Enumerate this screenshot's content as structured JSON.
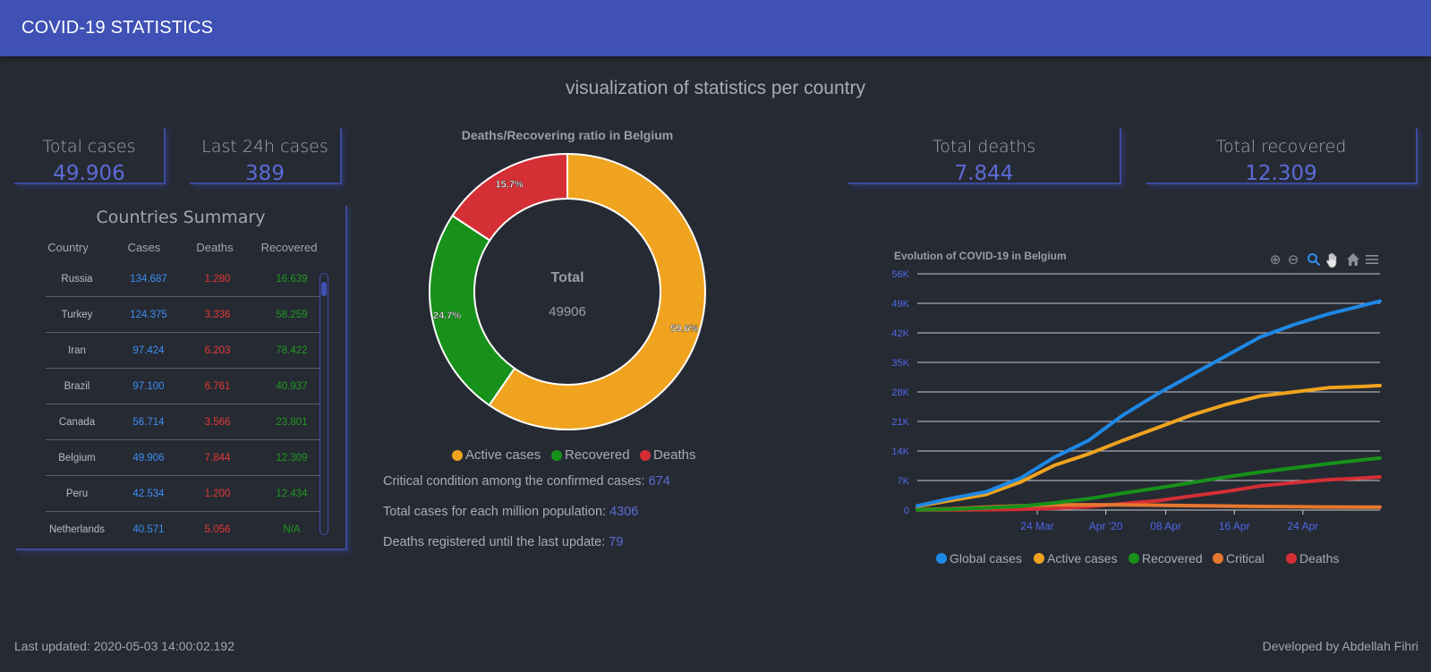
{
  "app": {
    "title": "COVID-19 STATISTICS"
  },
  "subtitle": "visualization of statistics per country",
  "cards": {
    "total_cases": {
      "label": "Total cases",
      "value": "49.906"
    },
    "last24h": {
      "label": "Last 24h cases",
      "value": "389"
    },
    "total_deaths": {
      "label": "Total deaths",
      "value": "7.844"
    },
    "total_recovered": {
      "label": "Total recovered",
      "value": "12.309"
    }
  },
  "summary": {
    "title": "Countries Summary",
    "headers": [
      "Country",
      "Cases",
      "Deaths",
      "Recovered"
    ],
    "rows": [
      [
        "Russia",
        "134.687",
        "1.280",
        "16.639"
      ],
      [
        "Turkey",
        "124.375",
        "3.336",
        "58.259"
      ],
      [
        "Iran",
        "97.424",
        "6.203",
        "78.422"
      ],
      [
        "Brazil",
        "97.100",
        "6.761",
        "40.937"
      ],
      [
        "Canada",
        "56.714",
        "3.566",
        "23.801"
      ],
      [
        "Belgium",
        "49.906",
        "7.844",
        "12.309"
      ],
      [
        "Peru",
        "42.534",
        "1.200",
        "12.434"
      ],
      [
        "Netherlands",
        "40.571",
        "5.056",
        "N/A"
      ]
    ]
  },
  "donut": {
    "title": "Deaths/Recovering ratio in Belgium",
    "center_label": "Total",
    "center_value": "49906",
    "legend": [
      "Active cases",
      "Recovered",
      "Deaths"
    ]
  },
  "stats": {
    "critical_label": "Critical condition among the confirmed cases: ",
    "critical_value": "674",
    "million_label": "Total cases for each million population: ",
    "million_value": "4306",
    "deaths_label": "Deaths registered until the last update: ",
    "deaths_value": "79"
  },
  "line_chart": {
    "title": "Evolution of COVID-19 in Belgium",
    "legend": [
      "Global cases",
      "Active cases",
      "Recovered",
      "Critical",
      "Deaths"
    ],
    "toolbar": [
      "zoom-in-icon",
      "zoom-out-icon",
      "zoom-select-icon",
      "pan-hand-icon",
      "home-icon",
      "menu-icon"
    ]
  },
  "chart_data": [
    {
      "type": "pie",
      "title": "Deaths/Recovering ratio in Belgium",
      "categories": [
        "Active cases",
        "Recovered",
        "Deaths"
      ],
      "values": [
        59.6,
        24.7,
        15.7
      ],
      "labels": [
        "59.6%",
        "24.7%",
        "15.7%"
      ],
      "colors": [
        "#f0a31e",
        "#17911a",
        "#d42f35"
      ]
    },
    {
      "type": "line",
      "title": "Evolution of COVID-19 in Belgium",
      "x_ticks": [
        "24 Mar",
        "Apr '20",
        "08 Apr",
        "16 Apr",
        "24 Apr"
      ],
      "y_ticks": [
        "0",
        "7K",
        "14K",
        "21K",
        "28K",
        "35K",
        "42K",
        "49K",
        "56K"
      ],
      "ylim": [
        0,
        56000
      ],
      "x": [
        "2020-03-10",
        "2020-03-14",
        "2020-03-18",
        "2020-03-22",
        "2020-03-26",
        "2020-03-30",
        "2020-04-03",
        "2020-04-07",
        "2020-04-11",
        "2020-04-15",
        "2020-04-19",
        "2020-04-23",
        "2020-04-27",
        "2020-05-01",
        "2020-05-03"
      ],
      "series": [
        {
          "name": "Global cases",
          "color": "#1e88e5",
          "values": [
            1000,
            2800,
            4300,
            7500,
            12500,
            16500,
            22500,
            27500,
            32000,
            36500,
            41000,
            44000,
            46500,
            48500,
            49500
          ]
        },
        {
          "name": "Active cases",
          "color": "#f0a31e",
          "values": [
            900,
            2300,
            3700,
            6600,
            10600,
            13300,
            16500,
            19500,
            22500,
            25000,
            27000,
            28000,
            29000,
            29300,
            29500
          ]
        },
        {
          "name": "Recovered",
          "color": "#17911a",
          "values": [
            50,
            200,
            500,
            900,
            1700,
            2700,
            4000,
            5200,
            6500,
            7800,
            9000,
            10000,
            11000,
            11900,
            12300
          ]
        },
        {
          "name": "Critical",
          "color": "#e8772e",
          "values": [
            100,
            300,
            700,
            1000,
            1200,
            1250,
            1200,
            1150,
            1050,
            950,
            850,
            780,
            720,
            690,
            674
          ]
        },
        {
          "name": "Deaths",
          "color": "#d42f35",
          "values": [
            10,
            30,
            80,
            180,
            400,
            800,
            1500,
            2200,
            3300,
            4400,
            5700,
            6500,
            7200,
            7600,
            7844
          ]
        }
      ]
    }
  ],
  "footer": {
    "updated": "Last updated: 2020-05-03 14:00:02.192",
    "author": "Developed by Abdellah Fihri"
  }
}
